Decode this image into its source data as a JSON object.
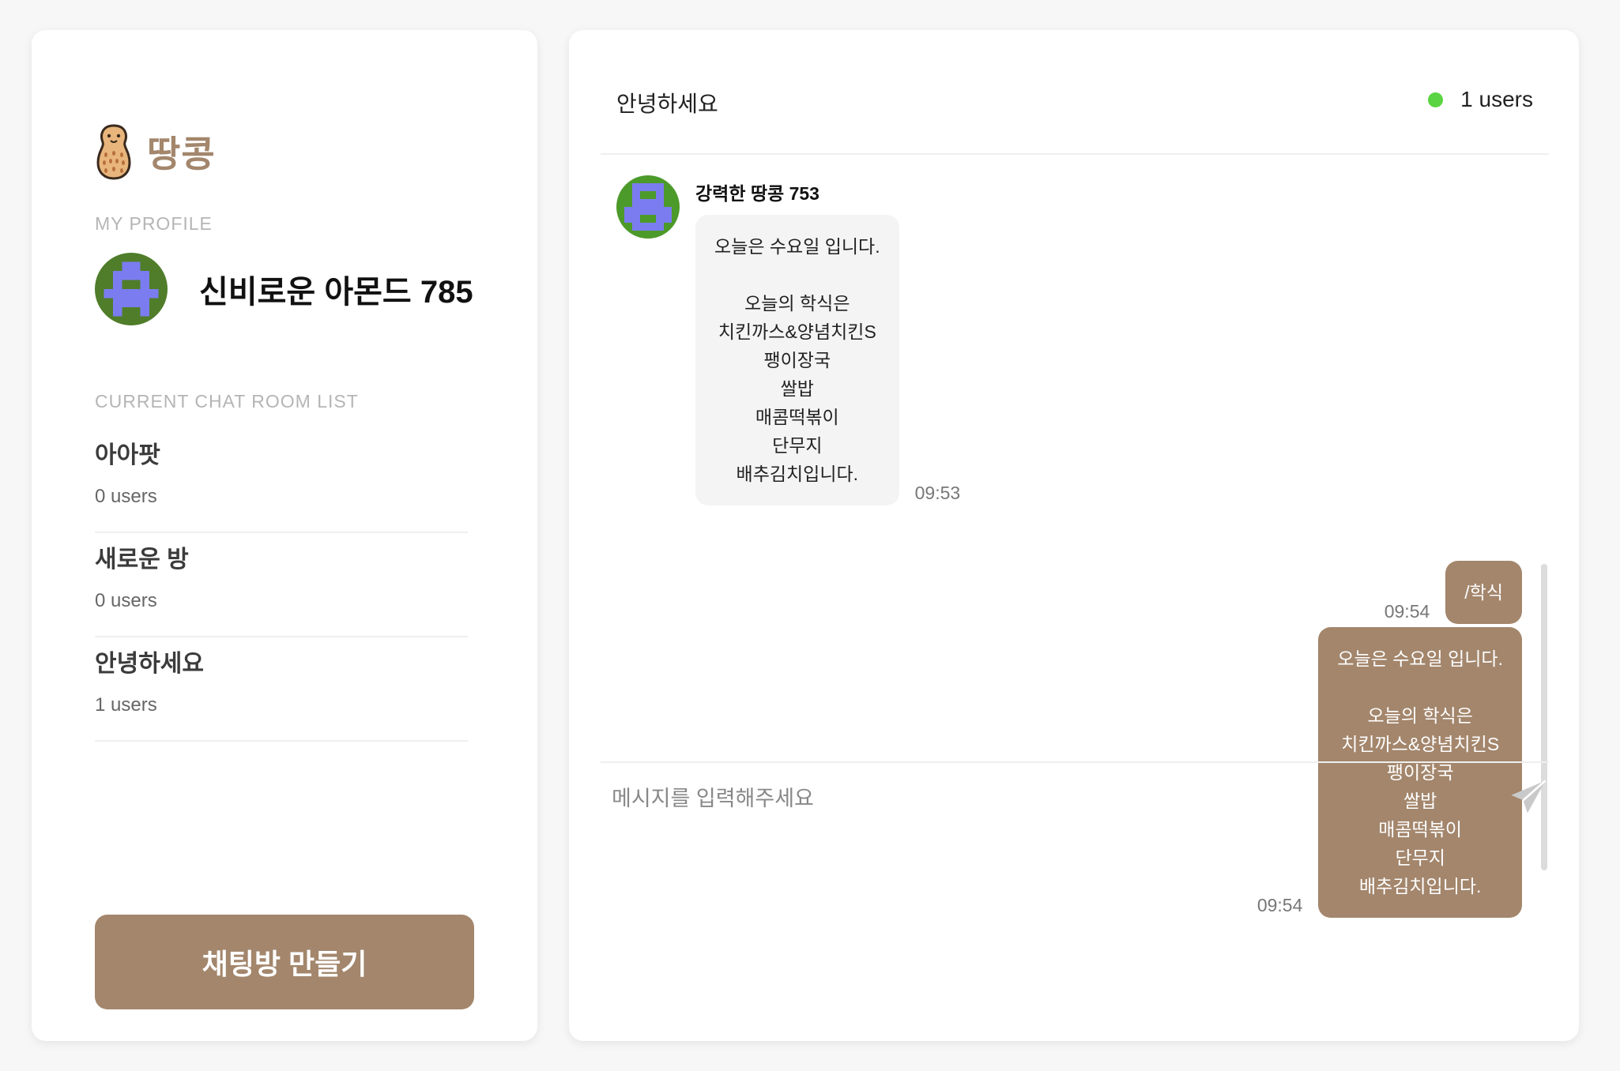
{
  "app": {
    "brand_name": "땅콩",
    "accent_color": "#a3866c",
    "logo_icon": "peanut-icon"
  },
  "sidebar": {
    "profile_label": "MY PROFILE",
    "profile_name": "신비로운 아몬드 785",
    "rooms_label": "CURRENT CHAT ROOM LIST",
    "rooms": [
      {
        "name": "아아팟",
        "count": "0 users"
      },
      {
        "name": "새로운 방",
        "count": "0 users"
      },
      {
        "name": "안녕하세요",
        "count": "1 users"
      }
    ],
    "create_button": "채팅방 만들기"
  },
  "chat": {
    "room_title": "안녕하세요",
    "online_count": "1 users",
    "online_color": "#5ad442",
    "messages": [
      {
        "sender": "강력한 땅콩 753",
        "text": "오늘은 수요일 입니다.\n\n오늘의 학식은\n치킨까스&양념치킨S\n팽이장국\n쌀밥\n매콤떡볶이\n단무지\n배추김치입니다.",
        "time": "09:53"
      },
      {
        "text": "/학식",
        "time": "09:54"
      },
      {
        "text": "오늘은 수요일 입니다.\n\n오늘의 학식은\n치킨까스&양념치킨S\n팽이장국\n쌀밥\n매콤떡볶이\n단무지\n배추김치입니다.",
        "time": "09:54"
      }
    ],
    "input_placeholder": "메시지를 입력해주세요",
    "send_icon": "send-icon"
  }
}
